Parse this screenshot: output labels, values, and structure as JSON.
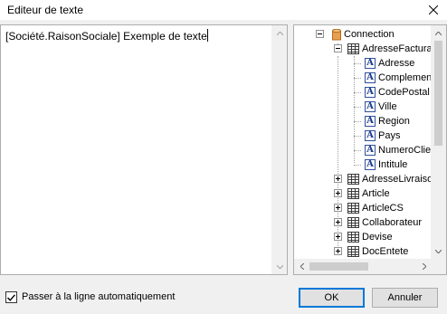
{
  "window": {
    "title": "Editeur de texte",
    "close_icon": "close-icon"
  },
  "editor": {
    "content": "[Société.RaisonSociale] Exemple de texte"
  },
  "tree": {
    "root": {
      "label": "Connection",
      "icon": "database-icon"
    },
    "expanded_table": {
      "label": "AdresseFacturation",
      "icon": "table-icon"
    },
    "fields": [
      {
        "label": "Adresse",
        "icon": "field-icon"
      },
      {
        "label": "Complement",
        "icon": "field-icon"
      },
      {
        "label": "CodePostal",
        "icon": "field-icon"
      },
      {
        "label": "Ville",
        "icon": "field-icon"
      },
      {
        "label": "Region",
        "icon": "field-icon"
      },
      {
        "label": "Pays",
        "icon": "field-icon"
      },
      {
        "label": "NumeroClient",
        "icon": "field-icon"
      },
      {
        "label": "Intitule",
        "icon": "field-icon"
      }
    ],
    "collapsed_tables": [
      {
        "label": "AdresseLivraison",
        "icon": "table-icon"
      },
      {
        "label": "Article",
        "icon": "table-icon"
      },
      {
        "label": "ArticleCS",
        "icon": "table-icon"
      },
      {
        "label": "Collaborateur",
        "icon": "table-icon"
      },
      {
        "label": "Devise",
        "icon": "table-icon"
      },
      {
        "label": "DocEntete",
        "icon": "table-icon"
      }
    ]
  },
  "footer": {
    "wrap_checkbox_label": "Passer à la ligne automatiquement",
    "wrap_checked": true,
    "ok_label": "OK",
    "cancel_label": "Annuler"
  },
  "colors": {
    "focus_border": "#0078d7",
    "database_icon": "#d98a3a",
    "field_icon": "#1f3f8f"
  }
}
